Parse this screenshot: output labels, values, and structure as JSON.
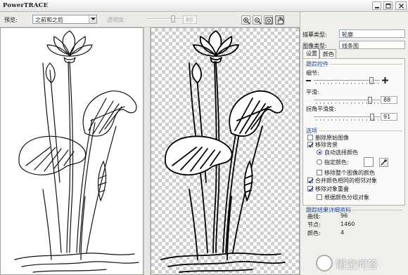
{
  "window": {
    "title": "PowerTRACE"
  },
  "toolbar": {
    "preview_label": "预览:",
    "preview_value": "之前和之后",
    "transparency_label": "透明度:",
    "transparency_value": "80",
    "transparency_level": 0.8
  },
  "settings": {
    "trace_type_label": "描摹类型:",
    "trace_type_value": "轮廓",
    "image_type_label": "图像类型:",
    "image_type_value": "线条图",
    "tabs": [
      {
        "label": "设置"
      },
      {
        "label": "颜色"
      }
    ],
    "trace_controls_title": "跟踪控件",
    "detail_label": "细节:",
    "detail_level": 0.9,
    "smoothing_label": "平滑:",
    "smoothing_value": "88",
    "corner_label": "拐角平滑度:",
    "corner_value": "91",
    "options_title": "选项",
    "delete_original": {
      "label": "删除原始图像",
      "checked": false
    },
    "remove_background": {
      "label": "移除背景",
      "checked": true
    },
    "auto_color": {
      "label": "自动选择颜色",
      "selected": true
    },
    "specify_color": {
      "label": "指定颜色:",
      "selected": false
    },
    "remove_whole_color": {
      "label": "移除整个图像的颜色",
      "checked": false
    },
    "merge_adjacent": {
      "label": "合并颜色相同的相邻对象",
      "checked": true
    },
    "remove_overlap": {
      "label": "移除对象重叠",
      "checked": true
    },
    "group_by_color": {
      "label": "根据颜色分组对象",
      "checked": false
    }
  },
  "results": {
    "title": "跟踪结果详细资料",
    "curves_label": "曲线:",
    "curves_value": "96",
    "nodes_label": "节点:",
    "nodes_value": "1460",
    "colors_label": "颜色:",
    "colors_value": "4"
  },
  "watermark": {
    "text": "悟空问答"
  }
}
